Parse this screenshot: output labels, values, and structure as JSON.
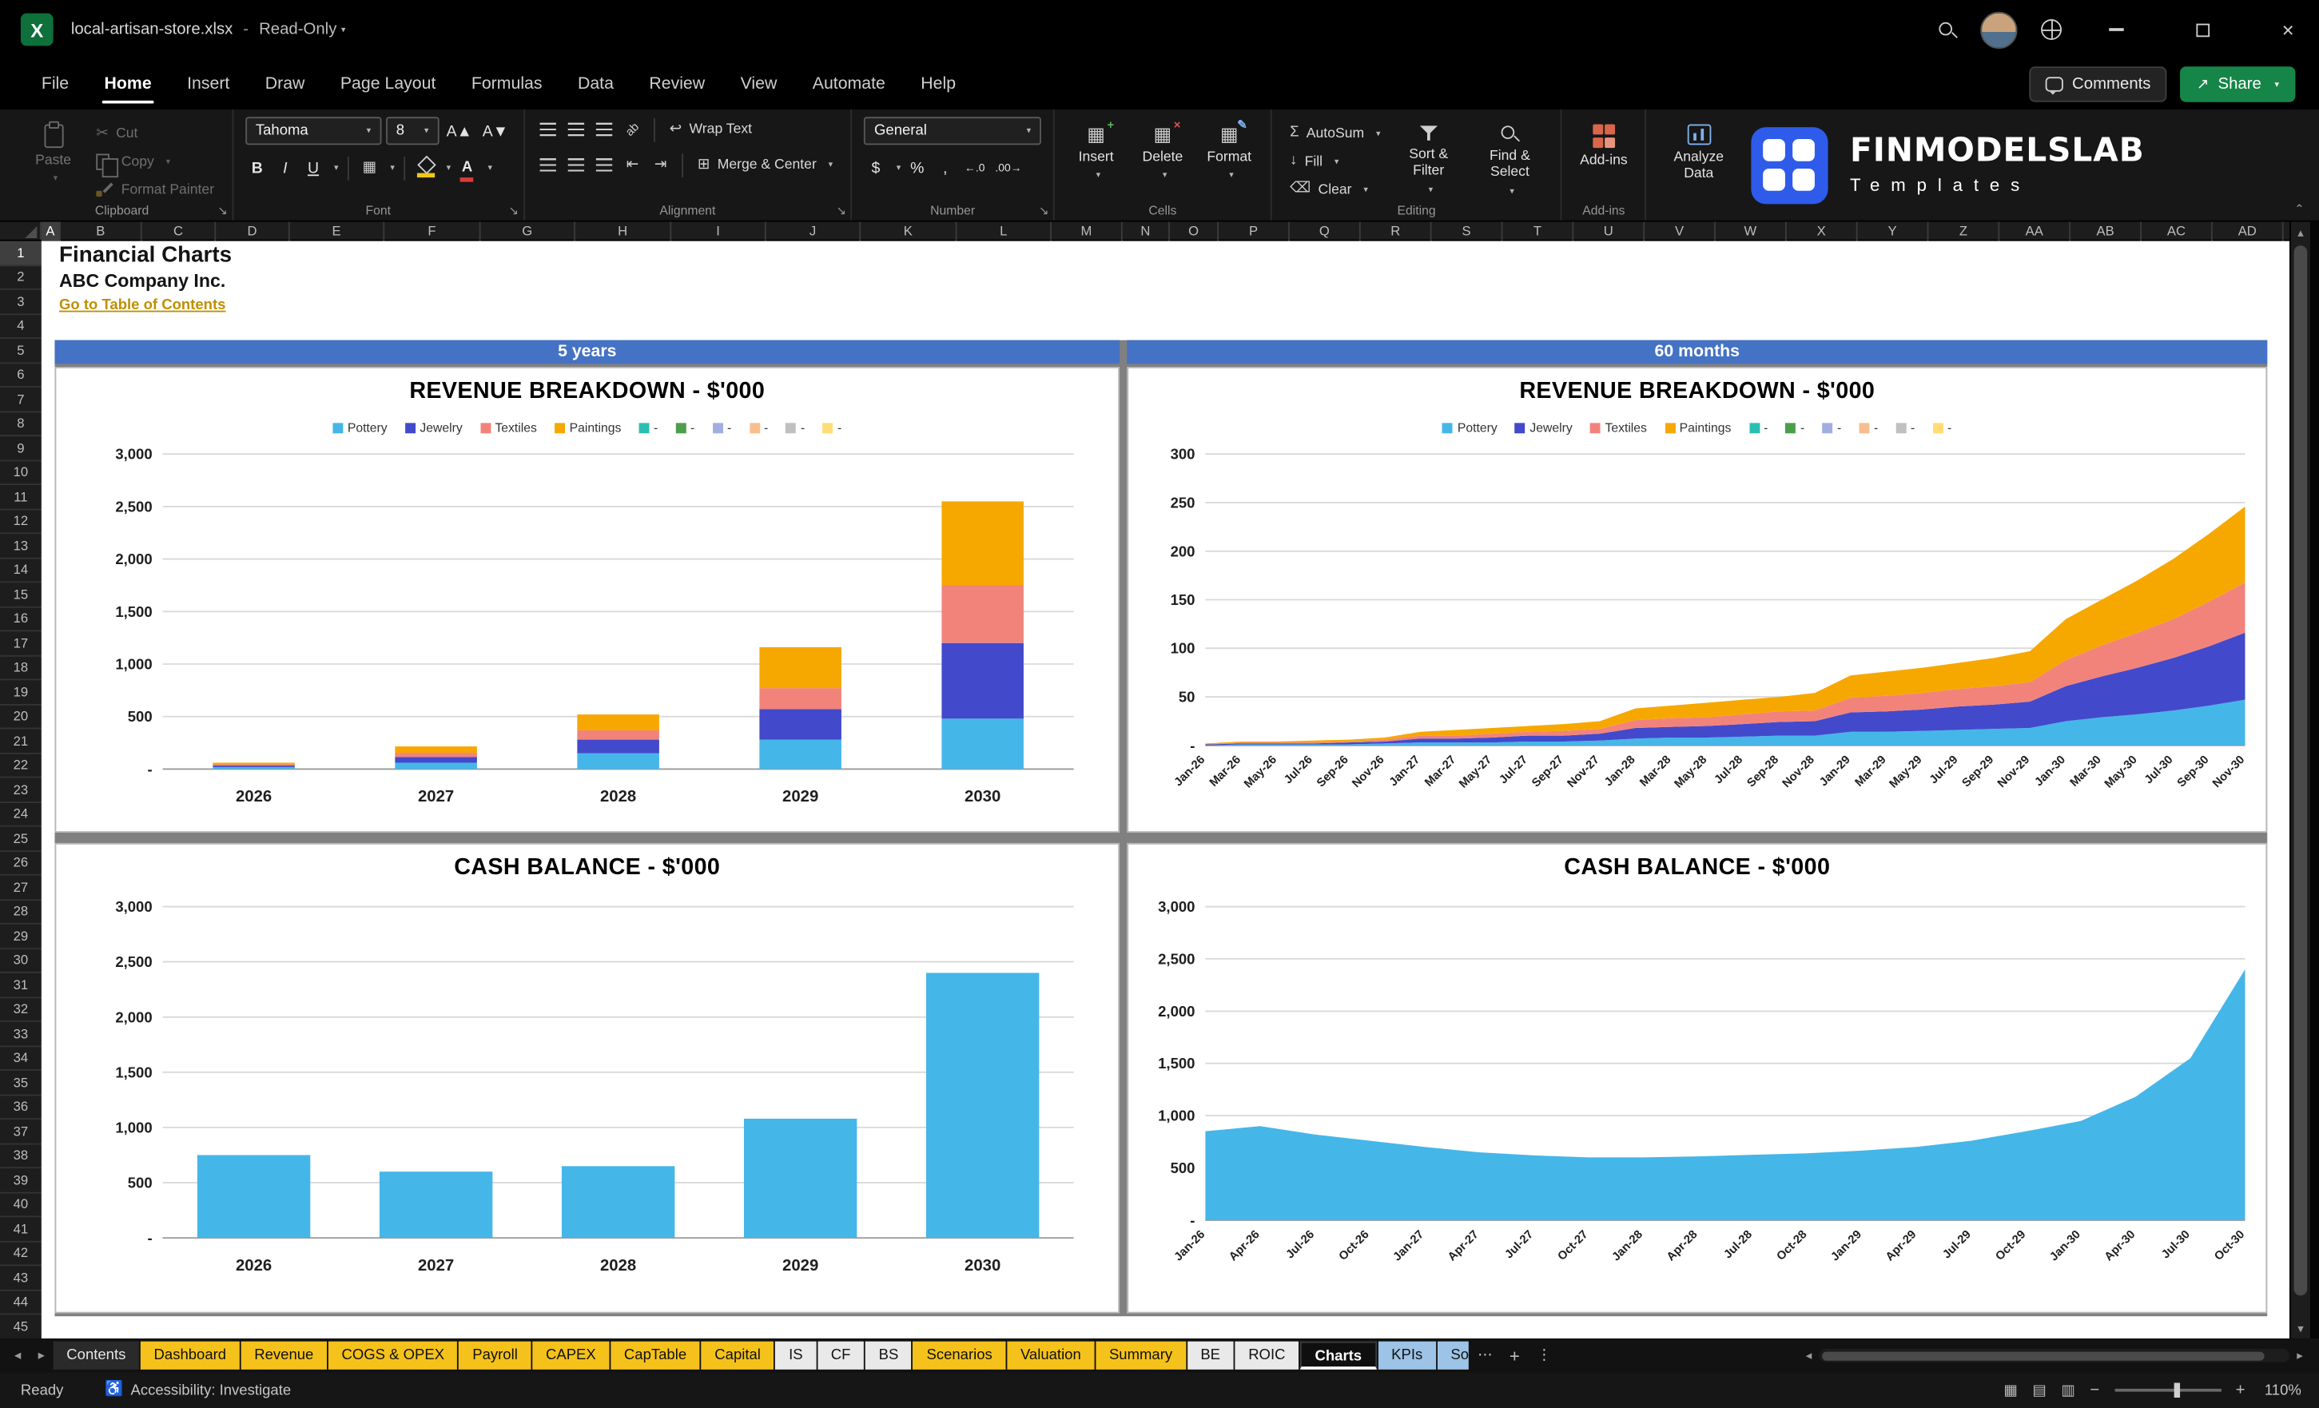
{
  "titlebar": {
    "app_icon_letter": "X",
    "title": "local-artisan-store.xlsx",
    "separator": "-",
    "mode": "Read-Only"
  },
  "menubar": {
    "items": [
      "File",
      "Home",
      "Insert",
      "Draw",
      "Page Layout",
      "Formulas",
      "Data",
      "Review",
      "View",
      "Automate",
      "Help"
    ],
    "active": "Home",
    "comments_label": "Comments",
    "share_label": "Share"
  },
  "ribbon": {
    "clipboard": {
      "group_label": "Clipboard",
      "paste": "Paste",
      "cut": "Cut",
      "copy": "Copy",
      "format_painter": "Format Painter"
    },
    "font": {
      "group_label": "Font",
      "family": "Tahoma",
      "size": "8",
      "bold": "B",
      "italic": "I",
      "underline": "U"
    },
    "alignment": {
      "group_label": "Alignment",
      "wrap_text": "Wrap Text",
      "merge_center": "Merge & Center"
    },
    "number": {
      "group_label": "Number",
      "format": "General",
      "currency": "$",
      "percent": "%",
      "comma": ",",
      "inc_decimal": "←.0",
      "dec_decimal": ".00→"
    },
    "cells": {
      "group_label": "Cells",
      "insert": "Insert",
      "delete": "Delete",
      "format": "Format"
    },
    "editing": {
      "group_label": "Editing",
      "autosum": "AutoSum",
      "fill": "Fill",
      "clear": "Clear",
      "sort_filter": "Sort & Filter",
      "find_select": "Find & Select"
    },
    "addins": {
      "group_label": "Add-ins",
      "button_label": "Add-ins"
    },
    "analyze": {
      "button_label": "Analyze Data"
    }
  },
  "brand": {
    "name": "FINMODELSLAB",
    "subtitle": "Templates"
  },
  "sheet": {
    "columns": [
      "A",
      "B",
      "C",
      "D",
      "E",
      "F",
      "G",
      "H",
      "I",
      "J",
      "K",
      "L",
      "M",
      "N",
      "O",
      "P",
      "Q",
      "R",
      "S",
      "T",
      "U",
      "V",
      "W",
      "X",
      "Y",
      "Z",
      "AA",
      "AB",
      "AC",
      "AD"
    ],
    "rows": 45,
    "cells": [
      {
        "ref": "A1",
        "text": "Financial Charts"
      },
      {
        "ref": "A2",
        "text": "ABC Company Inc."
      },
      {
        "ref": "A3",
        "text": "Go to Table of Contents"
      }
    ],
    "banners": [
      "5 years",
      "60 months"
    ]
  },
  "chart_data": [
    {
      "id": "rev5",
      "type": "bar",
      "stacked": true,
      "banner": "5 years",
      "title": "REVENUE BREAKDOWN - $'000",
      "categories": [
        "2026",
        "2027",
        "2028",
        "2029",
        "2030"
      ],
      "series": [
        {
          "name": "Pottery",
          "color": "#45B6E8",
          "values": [
            20,
            60,
            150,
            280,
            480
          ]
        },
        {
          "name": "Jewelry",
          "color": "#4349CB",
          "values": [
            15,
            55,
            130,
            290,
            720
          ]
        },
        {
          "name": "Textiles",
          "color": "#F2837B",
          "values": [
            10,
            40,
            90,
            200,
            550
          ]
        },
        {
          "name": "Paintings",
          "color": "#F6A800",
          "values": [
            15,
            60,
            150,
            390,
            800
          ]
        }
      ],
      "extra_legend": [
        {
          "label": "-",
          "color": "#2BBFB4"
        },
        {
          "label": "-",
          "color": "#4C9E4C"
        },
        {
          "label": "-",
          "color": "#A3AEE0"
        },
        {
          "label": "-",
          "color": "#F8BE8F"
        },
        {
          "label": "-",
          "color": "#C0C0C0"
        },
        {
          "label": "-",
          "color": "#FFDD75"
        }
      ],
      "ylim": [
        0,
        3000
      ],
      "yticks": [
        "3,000",
        "2,500",
        "2,000",
        "1,500",
        "1,000",
        "500",
        "-"
      ],
      "legend_position": "top",
      "grid": true
    },
    {
      "id": "rev60",
      "type": "area",
      "stacked": true,
      "banner": "60 months",
      "title": "REVENUE BREAKDOWN - $'000",
      "x": [
        "Jan-26",
        "Mar-26",
        "May-26",
        "Jul-26",
        "Sep-26",
        "Nov-26",
        "Jan-27",
        "Mar-27",
        "May-27",
        "Jul-27",
        "Sep-27",
        "Nov-27",
        "Jan-28",
        "Mar-28",
        "May-28",
        "Jul-28",
        "Sep-28",
        "Nov-28",
        "Jan-29",
        "Mar-29",
        "May-29",
        "Jul-29",
        "Sep-29",
        "Nov-29",
        "Jan-30",
        "Mar-30",
        "May-30",
        "Jul-30",
        "Sep-30",
        "Nov-30"
      ],
      "series": [
        {
          "name": "Pottery",
          "color": "#45B6E8",
          "values": [
            0,
            1,
            1,
            1,
            1,
            2,
            3,
            3,
            3,
            4,
            4,
            5,
            7,
            8,
            8,
            9,
            10,
            10,
            14,
            14,
            15,
            16,
            17,
            18,
            25,
            29,
            32,
            36,
            41,
            47
          ]
        },
        {
          "name": "Jewelry",
          "color": "#4349CB",
          "values": [
            1,
            1,
            1,
            1,
            2,
            2,
            4,
            4,
            5,
            6,
            6,
            7,
            11,
            11,
            12,
            13,
            14,
            15,
            20,
            21,
            22,
            24,
            25,
            27,
            36,
            42,
            48,
            54,
            61,
            69
          ]
        },
        {
          "name": "Textiles",
          "color": "#F2837B",
          "values": [
            0,
            1,
            1,
            1,
            1,
            2,
            3,
            3,
            4,
            4,
            5,
            5,
            8,
            9,
            9,
            10,
            11,
            11,
            15,
            16,
            17,
            18,
            19,
            20,
            27,
            32,
            36,
            40,
            46,
            52
          ]
        },
        {
          "name": "Paintings",
          "color": "#F6A800",
          "values": [
            1,
            1,
            1,
            2,
            2,
            2,
            4,
            6,
            6,
            6,
            7,
            8,
            12,
            13,
            15,
            15,
            15,
            18,
            23,
            25,
            26,
            27,
            29,
            32,
            42,
            47,
            54,
            62,
            70,
            78
          ]
        }
      ],
      "extra_legend": [
        {
          "label": "-",
          "color": "#2BBFB4"
        },
        {
          "label": "-",
          "color": "#4C9E4C"
        },
        {
          "label": "-",
          "color": "#A3AEE0"
        },
        {
          "label": "-",
          "color": "#F8BE8F"
        },
        {
          "label": "-",
          "color": "#C0C0C0"
        },
        {
          "label": "-",
          "color": "#FFDD75"
        }
      ],
      "ylim": [
        0,
        300
      ],
      "yticks": [
        "300",
        "250",
        "200",
        "150",
        "100",
        "50",
        "-"
      ],
      "legend_position": "top",
      "grid": true
    },
    {
      "id": "cash5",
      "type": "bar",
      "stacked": false,
      "title": "CASH BALANCE - $'000",
      "categories": [
        "2026",
        "2027",
        "2028",
        "2029",
        "2030"
      ],
      "series": [
        {
          "name": "Cash balance",
          "color": "#45B6E8",
          "values": [
            750,
            600,
            650,
            1080,
            2400
          ]
        }
      ],
      "ylim": [
        0,
        3000
      ],
      "yticks": [
        "3,000",
        "2,500",
        "2,000",
        "1,500",
        "1,000",
        "500",
        "-"
      ],
      "grid": true
    },
    {
      "id": "cash60",
      "type": "area",
      "stacked": false,
      "title": "CASH BALANCE - $'000",
      "x": [
        "Jan-26",
        "Apr-26",
        "Jul-26",
        "Oct-26",
        "Jan-27",
        "Apr-27",
        "Jul-27",
        "Oct-27",
        "Jan-28",
        "Apr-28",
        "Jul-28",
        "Oct-28",
        "Jan-29",
        "Apr-29",
        "Jul-29",
        "Oct-29",
        "Jan-30",
        "Apr-30",
        "Jul-30",
        "Oct-30"
      ],
      "series": [
        {
          "name": "Cash balance",
          "color": "#45B6E8",
          "values": [
            850,
            900,
            820,
            760,
            700,
            650,
            620,
            600,
            600,
            610,
            625,
            640,
            665,
            700,
            760,
            850,
            950,
            1180,
            1550,
            2400
          ]
        }
      ],
      "ylim": [
        0,
        3000
      ],
      "yticks": [
        "3,000",
        "2,500",
        "2,000",
        "1,500",
        "1,000",
        "500",
        "-"
      ],
      "grid": true
    }
  ],
  "sheet_tabs": {
    "active": "Charts",
    "tabs": [
      {
        "label": "Contents",
        "style": "dark"
      },
      {
        "label": "Dashboard",
        "style": "yellow"
      },
      {
        "label": "Revenue",
        "style": "yellow"
      },
      {
        "label": "COGS & OPEX",
        "style": "yellow"
      },
      {
        "label": "Payroll",
        "style": "yellow"
      },
      {
        "label": "CAPEX",
        "style": "yellow"
      },
      {
        "label": "CapTable",
        "style": "yellow"
      },
      {
        "label": "Capital",
        "style": "yellow"
      },
      {
        "label": "IS",
        "style": "white"
      },
      {
        "label": "CF",
        "style": "white"
      },
      {
        "label": "BS",
        "style": "white"
      },
      {
        "label": "Scenarios",
        "style": "yellow"
      },
      {
        "label": "Valuation",
        "style": "yellow"
      },
      {
        "label": "Summary",
        "style": "yellow"
      },
      {
        "label": "BE",
        "style": "white"
      },
      {
        "label": "ROIC",
        "style": "white"
      },
      {
        "label": "Charts",
        "style": "active"
      },
      {
        "label": "KPIs",
        "style": "blue"
      },
      {
        "label": "So",
        "style": "blue",
        "truncated": true
      }
    ]
  },
  "statusbar": {
    "ready": "Ready",
    "accessibility": "Accessibility: Investigate",
    "zoom_level": "110%"
  }
}
